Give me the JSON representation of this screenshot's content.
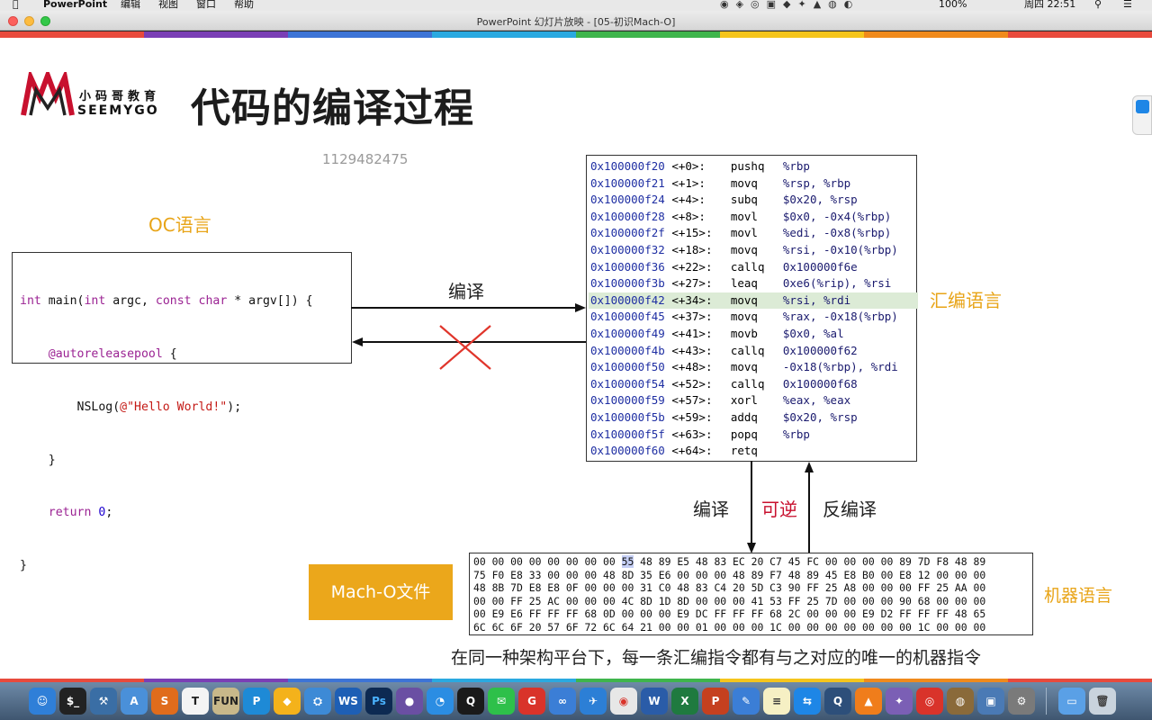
{
  "menubar": {
    "app": "PowerPoint",
    "items": [
      "编辑",
      "视图",
      "窗口",
      "帮助"
    ],
    "battery": "100%",
    "clock": "周四 22:51"
  },
  "window": {
    "title": "PowerPoint 幻灯片放映 - [05-初识Mach-O]"
  },
  "slide": {
    "logo_top": "小码哥教育",
    "logo_bottom": "SEEMYGO",
    "title": "代码的编译过程",
    "watermark": "1129482475",
    "oc_label": "OC语言",
    "oc_code": [
      "int main(int argc, const char * argv[]) {",
      "    @autoreleasepool {",
      "        NSLog(@\"Hello World!\");",
      "    }",
      "    return 0;",
      "}"
    ],
    "compile_label": "编译",
    "asm_label": "汇编语言",
    "asm_rows": [
      {
        "addr": "0x100000f20",
        "off": "<+0>:",
        "op": "pushq",
        "args": "%rbp"
      },
      {
        "addr": "0x100000f21",
        "off": "<+1>:",
        "op": "movq",
        "args": "%rsp, %rbp"
      },
      {
        "addr": "0x100000f24",
        "off": "<+4>:",
        "op": "subq",
        "args": "$0x20, %rsp"
      },
      {
        "addr": "0x100000f28",
        "off": "<+8>:",
        "op": "movl",
        "args": "$0x0, -0x4(%rbp)"
      },
      {
        "addr": "0x100000f2f",
        "off": "<+15>:",
        "op": "movl",
        "args": "%edi, -0x8(%rbp)"
      },
      {
        "addr": "0x100000f32",
        "off": "<+18>:",
        "op": "movq",
        "args": "%rsi, -0x10(%rbp)"
      },
      {
        "addr": "0x100000f36",
        "off": "<+22>:",
        "op": "callq",
        "args": "0x100000f6e"
      },
      {
        "addr": "0x100000f3b",
        "off": "<+27>:",
        "op": "leaq",
        "args": "0xe6(%rip), %rsi"
      },
      {
        "addr": "0x100000f42",
        "off": "<+34>:",
        "op": "movq",
        "args": "%rsi, %rdi"
      },
      {
        "addr": "0x100000f45",
        "off": "<+37>:",
        "op": "movq",
        "args": "%rax, -0x18(%rbp)"
      },
      {
        "addr": "0x100000f49",
        "off": "<+41>:",
        "op": "movb",
        "args": "$0x0, %al"
      },
      {
        "addr": "0x100000f4b",
        "off": "<+43>:",
        "op": "callq",
        "args": "0x100000f62"
      },
      {
        "addr": "0x100000f50",
        "off": "<+48>:",
        "op": "movq",
        "args": "-0x18(%rbp), %rdi"
      },
      {
        "addr": "0x100000f54",
        "off": "<+52>:",
        "op": "callq",
        "args": "0x100000f68"
      },
      {
        "addr": "0x100000f59",
        "off": "<+57>:",
        "op": "xorl",
        "args": "%eax, %eax"
      },
      {
        "addr": "0x100000f5b",
        "off": "<+59>:",
        "op": "addq",
        "args": "$0x20, %rsp"
      },
      {
        "addr": "0x100000f5f",
        "off": "<+63>:",
        "op": "popq",
        "args": "%rbp"
      },
      {
        "addr": "0x100000f60",
        "off": "<+64>:",
        "op": "retq",
        "args": ""
      }
    ],
    "highlight_row": 8,
    "down_label": "编译",
    "mid_label": "可逆",
    "up_label": "反编译",
    "machine_label": "机器语言",
    "macho_label": "Mach-O文件",
    "hex_first_prefix": "00 00 00 00 00 00 00 00 ",
    "hex_first_highlight": "55",
    "hex_first_suffix": " 48 89 E5 48 83 EC 20 C7 45 FC 00 00 00 00 89 7D F8 48 89",
    "hex_rows": [
      "75 F0 E8 33 00 00 00 48 8D 35 E6 00 00 00 48 89 F7 48 89 45 E8 B0 00 E8 12 00 00 00",
      "48 8B 7D E8 E8 0F 00 00 00 31 C0 48 83 C4 20 5D C3 90 FF 25 A8 00 00 00 FF 25 AA 00",
      "00 00 FF 25 AC 00 00 00 4C 8D 1D 8D 00 00 00 41 53 FF 25 7D 00 00 00 90 68 00 00 00",
      "00 E9 E6 FF FF FF 68 0D 00 00 00 E9 DC FF FF FF 68 2C 00 00 00 E9 D2 FF FF FF 48 65",
      "6C 6C 6F 20 57 6F 72 6C 64 21 00 00 01 00 00 00 1C 00 00 00 00 00 00 00 1C 00 00 00"
    ],
    "footer": "在同一种架构平台下，每一条汇编指令都有与之对应的唯一的机器指令"
  },
  "colors": {
    "orange": "#e8a417",
    "asm_blue": "#1f2fa3",
    "keyword_purple": "#9b2393",
    "highlight_green": "#dcebd6",
    "red": "#c8102e"
  }
}
